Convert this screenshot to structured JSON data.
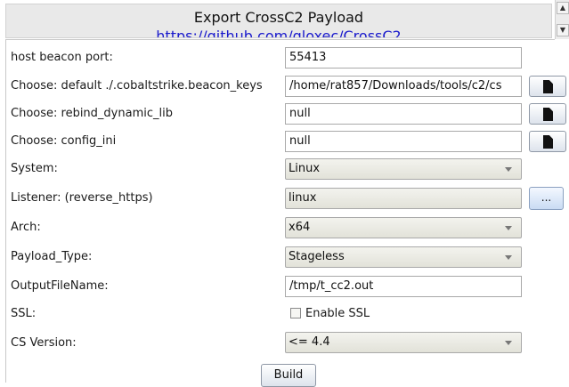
{
  "banner": {
    "title": "Export CrossC2 Payload",
    "link": "https://github.com/gloxec/CrossC2"
  },
  "scrollbar": {
    "up_icon": "triangle-up-icon",
    "down_icon": "triangle-down-icon"
  },
  "fields": {
    "port": {
      "label": "host beacon port:",
      "value": "55413"
    },
    "beacon_keys": {
      "label": "Choose: default ./.cobaltstrike.beacon_keys",
      "value": "/home/rat857/Downloads/tools/c2/cs"
    },
    "rebind": {
      "label": "Choose: rebind_dynamic_lib",
      "value": "null"
    },
    "config": {
      "label": "Choose: config_ini",
      "value": "null"
    },
    "system": {
      "label": "System:",
      "value": "Linux"
    },
    "listener": {
      "label": "Listener: (reverse_https)",
      "value": "linux",
      "button": "..."
    },
    "arch": {
      "label": "Arch:",
      "value": "x64"
    },
    "payload_type": {
      "label": "Payload_Type:",
      "value": "Stageless"
    },
    "output": {
      "label": "OutputFileName:",
      "value": "/tmp/t_cc2.out"
    },
    "ssl": {
      "label": "SSL:",
      "checkbox_label": "Enable SSL",
      "checked": false
    },
    "cs_version": {
      "label": "CS Version:",
      "value": "<= 4.4"
    }
  },
  "icons": {
    "file_browse": "file-icon",
    "dropdown": "chevron-down-icon"
  },
  "build_button": "Build",
  "colors": {
    "link": "#1a1acc",
    "banner_bg": "#e9e9e9",
    "combo_bg": "#e2e2d9"
  }
}
